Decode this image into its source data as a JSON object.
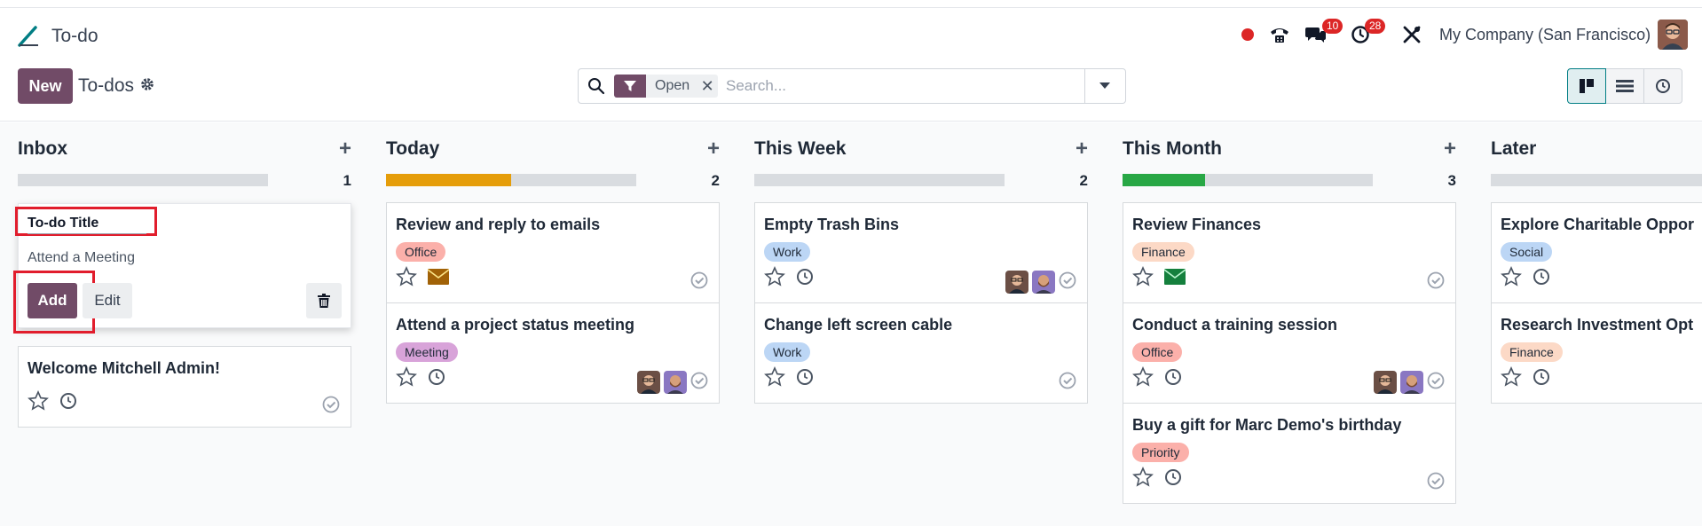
{
  "app": {
    "title": "To-do"
  },
  "navbar": {
    "messages_badge": "10",
    "activities_badge": "28",
    "company": "My Company (San Francisco)"
  },
  "control_panel": {
    "new_label": "New",
    "title": "To-dos",
    "search": {
      "facet_value": "Open",
      "placeholder": "Search..."
    }
  },
  "colors": {
    "brand": "#714b67",
    "danger": "#dc2626",
    "accent": "#017e84"
  },
  "columns": [
    {
      "title": "Inbox",
      "count": "1",
      "progress": {
        "orange": 0,
        "green": 0
      }
    },
    {
      "title": "Today",
      "count": "2",
      "progress": {
        "orange": 0.5,
        "green": 0
      }
    },
    {
      "title": "This Week",
      "count": "2",
      "progress": {
        "orange": 0,
        "green": 0
      }
    },
    {
      "title": "This Month",
      "count": "3",
      "progress": {
        "orange": 0,
        "green": 0.33
      }
    },
    {
      "title": "Later",
      "count": "",
      "progress": {
        "orange": 0,
        "green": 0
      }
    }
  ],
  "quick_create": {
    "title_label": "To-do Title",
    "description_placeholder": "Attend a Meeting",
    "add_label": "Add",
    "edit_label": "Edit"
  },
  "cards": {
    "inbox": [
      {
        "title": "Welcome Mitchell Admin!"
      }
    ],
    "today": [
      {
        "title": "Review and reply to emails",
        "tag": "Office"
      },
      {
        "title": "Attend a project status meeting",
        "tag": "Meeting"
      }
    ],
    "this_week": [
      {
        "title": "Empty Trash Bins",
        "tag": "Work"
      },
      {
        "title": "Change left screen cable",
        "tag": "Work"
      }
    ],
    "this_month": [
      {
        "title": "Review Finances",
        "tag": "Finance"
      },
      {
        "title": "Conduct a training session",
        "tag": "Office"
      },
      {
        "title": "Buy a gift for Marc Demo's birthday",
        "tag": "Priority"
      }
    ],
    "later": [
      {
        "title": "Explore Charitable Oppor",
        "tag": "Social"
      },
      {
        "title": "Research Investment Opt",
        "tag": "Finance"
      }
    ]
  }
}
